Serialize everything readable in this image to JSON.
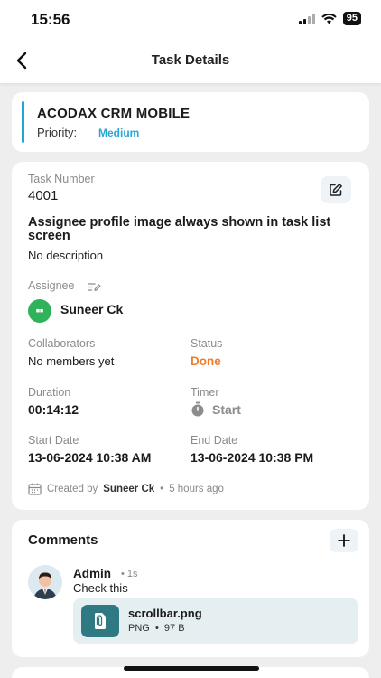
{
  "status_bar": {
    "time": "15:56",
    "battery": "95"
  },
  "nav": {
    "title": "Task Details",
    "back_icon": "chevron-left-icon"
  },
  "project": {
    "name": "ACODAX CRM MOBILE",
    "priority_label": "Priority:",
    "priority_value": "Medium",
    "accent_color": "#1fa6d7"
  },
  "task": {
    "number_label": "Task Number",
    "number": "4001",
    "title": "Assignee profile image always shown in task list screen",
    "description": "No description",
    "assignee_label": "Assignee",
    "assignee_name": "Suneer Ck",
    "collaborators_label": "Collaborators",
    "collaborators_value": "No members yet",
    "status_label": "Status",
    "status_value": "Done",
    "duration_label": "Duration",
    "duration_value": "00:14:12",
    "timer_label": "Timer",
    "timer_action": "Start",
    "start_date_label": "Start Date",
    "start_date": "13-06-2024 10:38 AM",
    "end_date_label": "End Date",
    "end_date": "13-06-2024 10:38 PM",
    "created_by_prefix": "Created by",
    "created_by": "Suneer Ck",
    "created_ago": "5 hours ago"
  },
  "comments": {
    "title": "Comments",
    "items": [
      {
        "author": "Admin",
        "time": "1s",
        "text": "Check this",
        "attachment": {
          "name": "scrollbar.png",
          "type": "PNG",
          "size": "97 B"
        }
      }
    ]
  },
  "colors": {
    "status_done": "#ef7d2b",
    "priority": "#2aa5d6",
    "assignee_avatar": "#2fb25a",
    "file_icon_bg": "#2f7a82"
  }
}
